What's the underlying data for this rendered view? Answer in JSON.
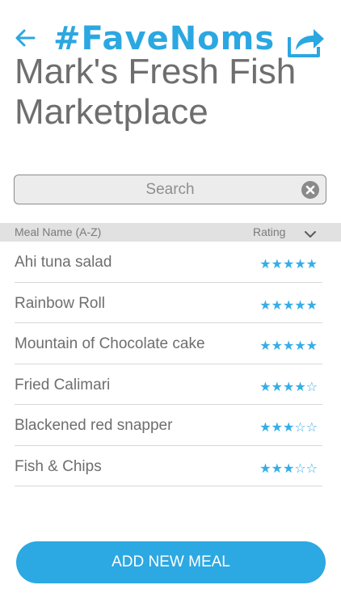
{
  "header": {
    "back_icon": "left-arrow-icon",
    "brand": "#FaveNoms",
    "share_icon": "share-icon",
    "accent_color": "#2ba7e1"
  },
  "restaurant": {
    "name": "Mark's Fresh Fish Marketplace"
  },
  "search": {
    "placeholder": "Search",
    "value": "",
    "clear_icon": "clear-circle-x-icon"
  },
  "table": {
    "name_header": "Meal Name (A-Z)",
    "rating_header": "Rating",
    "sort_icon": "chevron-down-icon",
    "rows": [
      {
        "name": "Ahi tuna salad",
        "rating": 5,
        "stars": "★★★★★"
      },
      {
        "name": "Rainbow Roll",
        "rating": 5,
        "stars": "★★★★★"
      },
      {
        "name": "Mountain of Chocolate cake",
        "rating": 5,
        "stars": "★★★★★"
      },
      {
        "name": "Fried Calimari",
        "rating": 4,
        "stars": "★★★★☆"
      },
      {
        "name": "Blackened red snapper",
        "rating": 3,
        "stars": "★★★☆☆"
      },
      {
        "name": "Fish & Chips",
        "rating": 3,
        "stars": "★★★☆☆"
      }
    ]
  },
  "actions": {
    "add_meal_label": "ADD NEW MEAL",
    "button_color": "#2ca8e2"
  }
}
